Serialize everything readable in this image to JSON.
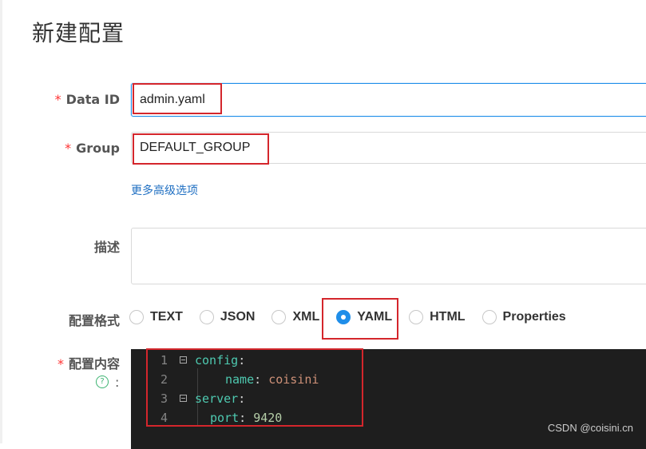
{
  "page": {
    "title": "新建配置"
  },
  "form": {
    "data_id": {
      "label": "Data ID",
      "value": "admin.yaml",
      "required": "*"
    },
    "group": {
      "label": "Group",
      "value": "DEFAULT_GROUP",
      "required": "*"
    },
    "advanced_link": "更多高级选项",
    "description": {
      "label": "描述",
      "value": ""
    },
    "format": {
      "label": "配置格式",
      "options": [
        "TEXT",
        "JSON",
        "XML",
        "YAML",
        "HTML",
        "Properties"
      ],
      "selected": "YAML"
    },
    "content": {
      "label": "配置内容",
      "required": "*",
      "help": "?",
      "colon": ":"
    }
  },
  "editor": {
    "lines": [
      {
        "num": "1",
        "key": "config",
        "punct": ":",
        "value": ""
      },
      {
        "num": "2",
        "key": "name",
        "punct": ": ",
        "value": "coisini"
      },
      {
        "num": "3",
        "key": "server",
        "punct": ":",
        "value": ""
      },
      {
        "num": "4",
        "key": "port",
        "punct": ": ",
        "value": "9420"
      }
    ]
  },
  "watermark": "CSDN @coisini.cn",
  "colors": {
    "accent": "#1f8ee9",
    "highlight_box": "#d4262c",
    "required": "#ff3333"
  }
}
